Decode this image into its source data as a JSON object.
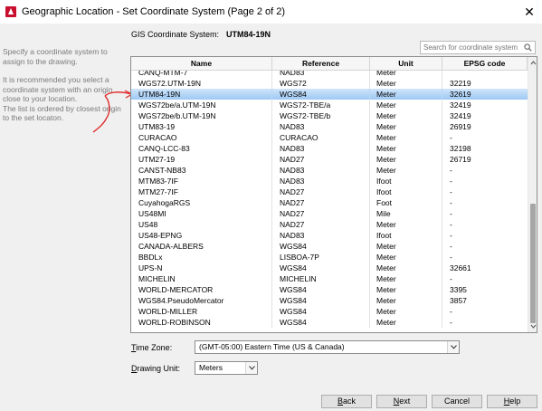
{
  "window": {
    "title": "Geographic Location - Set Coordinate System (Page 2 of 2)",
    "close_glyph": "✕"
  },
  "left_info": {
    "p1": "Specify a coordinate system to assign to the drawing.",
    "p2": "It is recommended you select a coordinate system with an origin close to your location.",
    "p3": "The list is ordered by closest origin to the set locaton."
  },
  "gis": {
    "label": "GIS Coordinate System:",
    "value": "UTM84-19N"
  },
  "search": {
    "placeholder": "Search for coordinate system"
  },
  "table": {
    "headers": {
      "name": "Name",
      "reference": "Reference",
      "unit": "Unit",
      "epsg": "EPSG code"
    },
    "rows": [
      {
        "name": "CANQ-MTM-7",
        "reference": "NAD83",
        "unit": "Meter",
        "epsg": ""
      },
      {
        "name": "WGS72.UTM-19N",
        "reference": "WGS72",
        "unit": "Meter",
        "epsg": "32219"
      },
      {
        "name": "UTM84-19N",
        "reference": "WGS84",
        "unit": "Meter",
        "epsg": "32619",
        "selected": true
      },
      {
        "name": "WGS72be/a.UTM-19N",
        "reference": "WGS72-TBE/a",
        "unit": "Meter",
        "epsg": "32419"
      },
      {
        "name": "WGS72be/b.UTM-19N",
        "reference": "WGS72-TBE/b",
        "unit": "Meter",
        "epsg": "32419"
      },
      {
        "name": "UTM83-19",
        "reference": "NAD83",
        "unit": "Meter",
        "epsg": "26919"
      },
      {
        "name": "CURACAO",
        "reference": "CURACAO",
        "unit": "Meter",
        "epsg": "-"
      },
      {
        "name": "CANQ-LCC-83",
        "reference": "NAD83",
        "unit": "Meter",
        "epsg": "32198"
      },
      {
        "name": "UTM27-19",
        "reference": "NAD27",
        "unit": "Meter",
        "epsg": "26719"
      },
      {
        "name": "CANST-NB83",
        "reference": "NAD83",
        "unit": "Meter",
        "epsg": "-"
      },
      {
        "name": "MTM83-7IF",
        "reference": "NAD83",
        "unit": "Ifoot",
        "epsg": "-"
      },
      {
        "name": "MTM27-7IF",
        "reference": "NAD27",
        "unit": "Ifoot",
        "epsg": "-"
      },
      {
        "name": "CuyahogaRGS",
        "reference": "NAD27",
        "unit": "Foot",
        "epsg": "-"
      },
      {
        "name": "US48MI",
        "reference": "NAD27",
        "unit": "Mile",
        "epsg": "-"
      },
      {
        "name": "US48",
        "reference": "NAD27",
        "unit": "Meter",
        "epsg": "-"
      },
      {
        "name": "US48-EPNG",
        "reference": "NAD83",
        "unit": "Ifoot",
        "epsg": "-"
      },
      {
        "name": "CANADA-ALBERS",
        "reference": "WGS84",
        "unit": "Meter",
        "epsg": "-"
      },
      {
        "name": "BBDLx",
        "reference": "LISBOA-7P",
        "unit": "Meter",
        "epsg": "-"
      },
      {
        "name": "UPS-N",
        "reference": "WGS84",
        "unit": "Meter",
        "epsg": "32661"
      },
      {
        "name": "MICHELIN",
        "reference": "MICHELIN",
        "unit": "Meter",
        "epsg": "-"
      },
      {
        "name": "WORLD-MERCATOR",
        "reference": "WGS84",
        "unit": "Meter",
        "epsg": "3395"
      },
      {
        "name": "WGS84.PseudoMercator",
        "reference": "WGS84",
        "unit": "Meter",
        "epsg": "3857"
      },
      {
        "name": "WORLD-MILLER",
        "reference": "WGS84",
        "unit": "Meter",
        "epsg": "-"
      },
      {
        "name": "WORLD-ROBINSON",
        "reference": "WGS84",
        "unit": "Meter",
        "epsg": "-"
      }
    ]
  },
  "time_zone": {
    "label_prefix": "",
    "label_access": "T",
    "label_rest": "ime Zone:",
    "value": "(GMT-05:00) Eastern Time (US & Canada)"
  },
  "drawing_unit": {
    "label_access": "D",
    "label_rest": "rawing Unit:",
    "value": "Meters"
  },
  "buttons": {
    "back_access": "B",
    "back_rest": "ack",
    "next_access": "N",
    "next_rest": "ext",
    "cancel": "Cancel",
    "help_access": "H",
    "help_rest": "elp"
  },
  "colors": {
    "selection": "#9ec8f3",
    "annotation": "#e02020"
  },
  "icons": [
    "search-icon",
    "close-icon",
    "chevron-down-icon",
    "scroll-up-icon",
    "scroll-down-icon"
  ]
}
